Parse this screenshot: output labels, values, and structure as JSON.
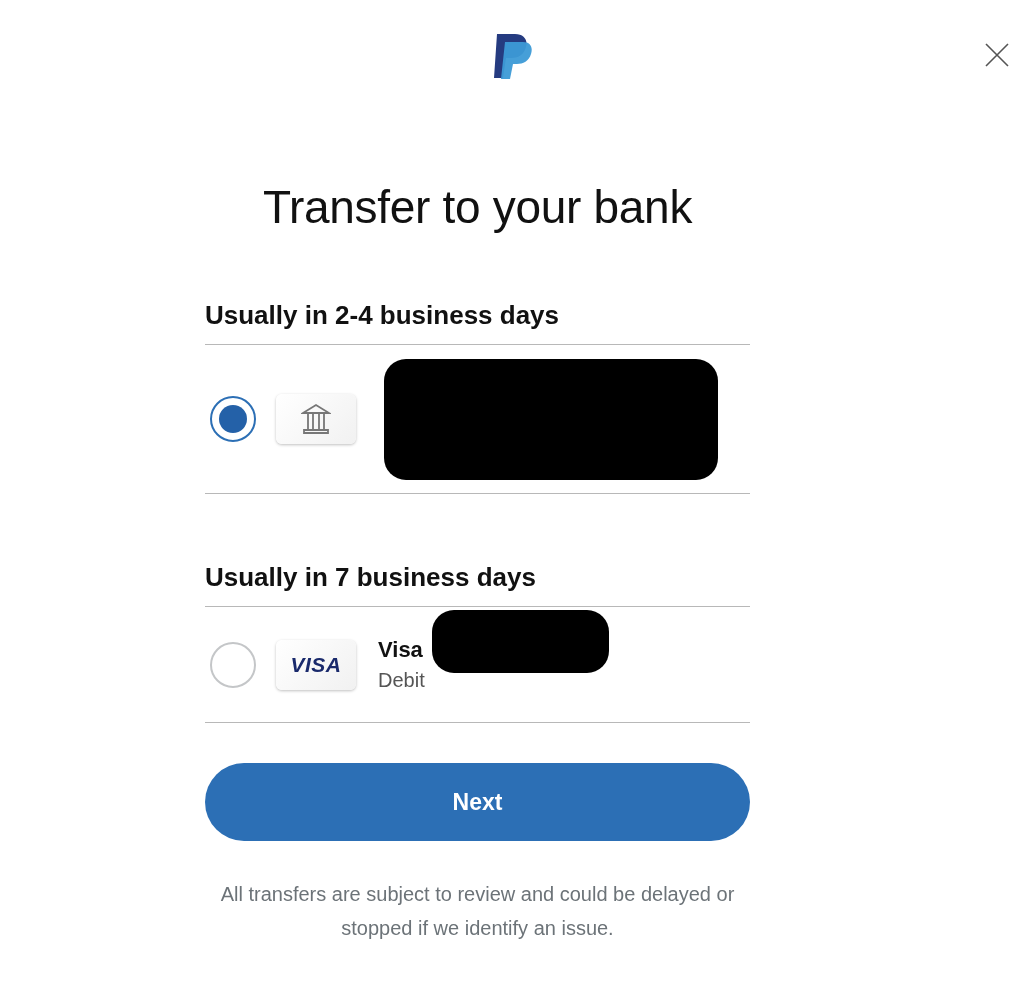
{
  "title": "Transfer to your bank",
  "sections": [
    {
      "heading": "Usually in 2-4 business days",
      "options": [
        {
          "kind": "bank",
          "selected": true,
          "redacted": true
        }
      ]
    },
    {
      "heading": "Usually in 7 business days",
      "options": [
        {
          "kind": "visa",
          "selected": false,
          "logo_text": "VISA",
          "name_lines": [
            "Visa"
          ],
          "detail": "Debit",
          "redacted": true
        }
      ]
    }
  ],
  "button": "Next",
  "footer": "All transfers are subject to review and could be delayed or stopped if we identify an issue."
}
